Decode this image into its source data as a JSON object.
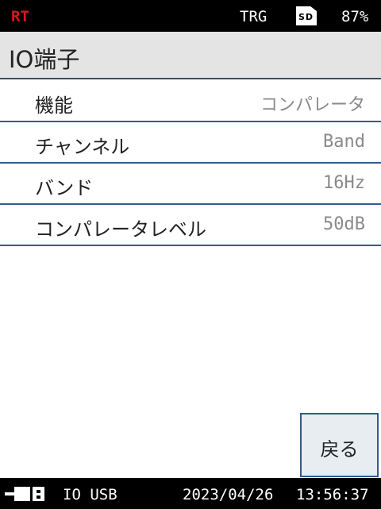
{
  "status_bar": {
    "mode": "RT",
    "trigger": "TRG",
    "sd_label": "SD",
    "battery": "87%"
  },
  "colors": {
    "mode_red": "#e0141e",
    "row_border": "#355a8a",
    "title_bg": "#e4e4e4",
    "value_gray": "#8a8a8a"
  },
  "header": {
    "title": "IO端子"
  },
  "settings": {
    "rows": [
      {
        "label": "機能",
        "value": "コンパレータ"
      },
      {
        "label": "チャンネル",
        "value": "Band"
      },
      {
        "label": "バンド",
        "value": "16Hz"
      },
      {
        "label": "コンパレータレベル",
        "value": "50dB"
      }
    ]
  },
  "buttons": {
    "back_label": "戻る"
  },
  "footer": {
    "connection": "IO USB",
    "date": "2023/04/26",
    "time": "13:56:37",
    "power_icon": "ac-plug-icon"
  }
}
